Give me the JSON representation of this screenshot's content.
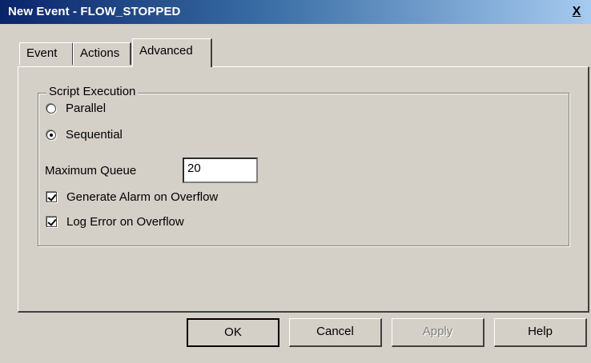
{
  "window": {
    "title": "New Event - FLOW_STOPPED",
    "close_label": "X",
    "close_icon": "close-icon"
  },
  "tabs": [
    {
      "label": "Event",
      "selected": false
    },
    {
      "label": "Actions",
      "selected": false
    },
    {
      "label": "Advanced",
      "selected": true
    }
  ],
  "script_execution": {
    "group_label": "Script Execution",
    "options": [
      {
        "label": "Parallel",
        "selected": false
      },
      {
        "label": "Sequential",
        "selected": true
      }
    ],
    "max_queue_label": "Maximum Queue",
    "max_queue_value": "20",
    "checkboxes": [
      {
        "label": "Generate Alarm on Overflow",
        "checked": true
      },
      {
        "label": "Log Error on Overflow",
        "checked": true
      }
    ]
  },
  "buttons": {
    "ok": "OK",
    "cancel": "Cancel",
    "apply": "Apply",
    "help": "Help"
  }
}
